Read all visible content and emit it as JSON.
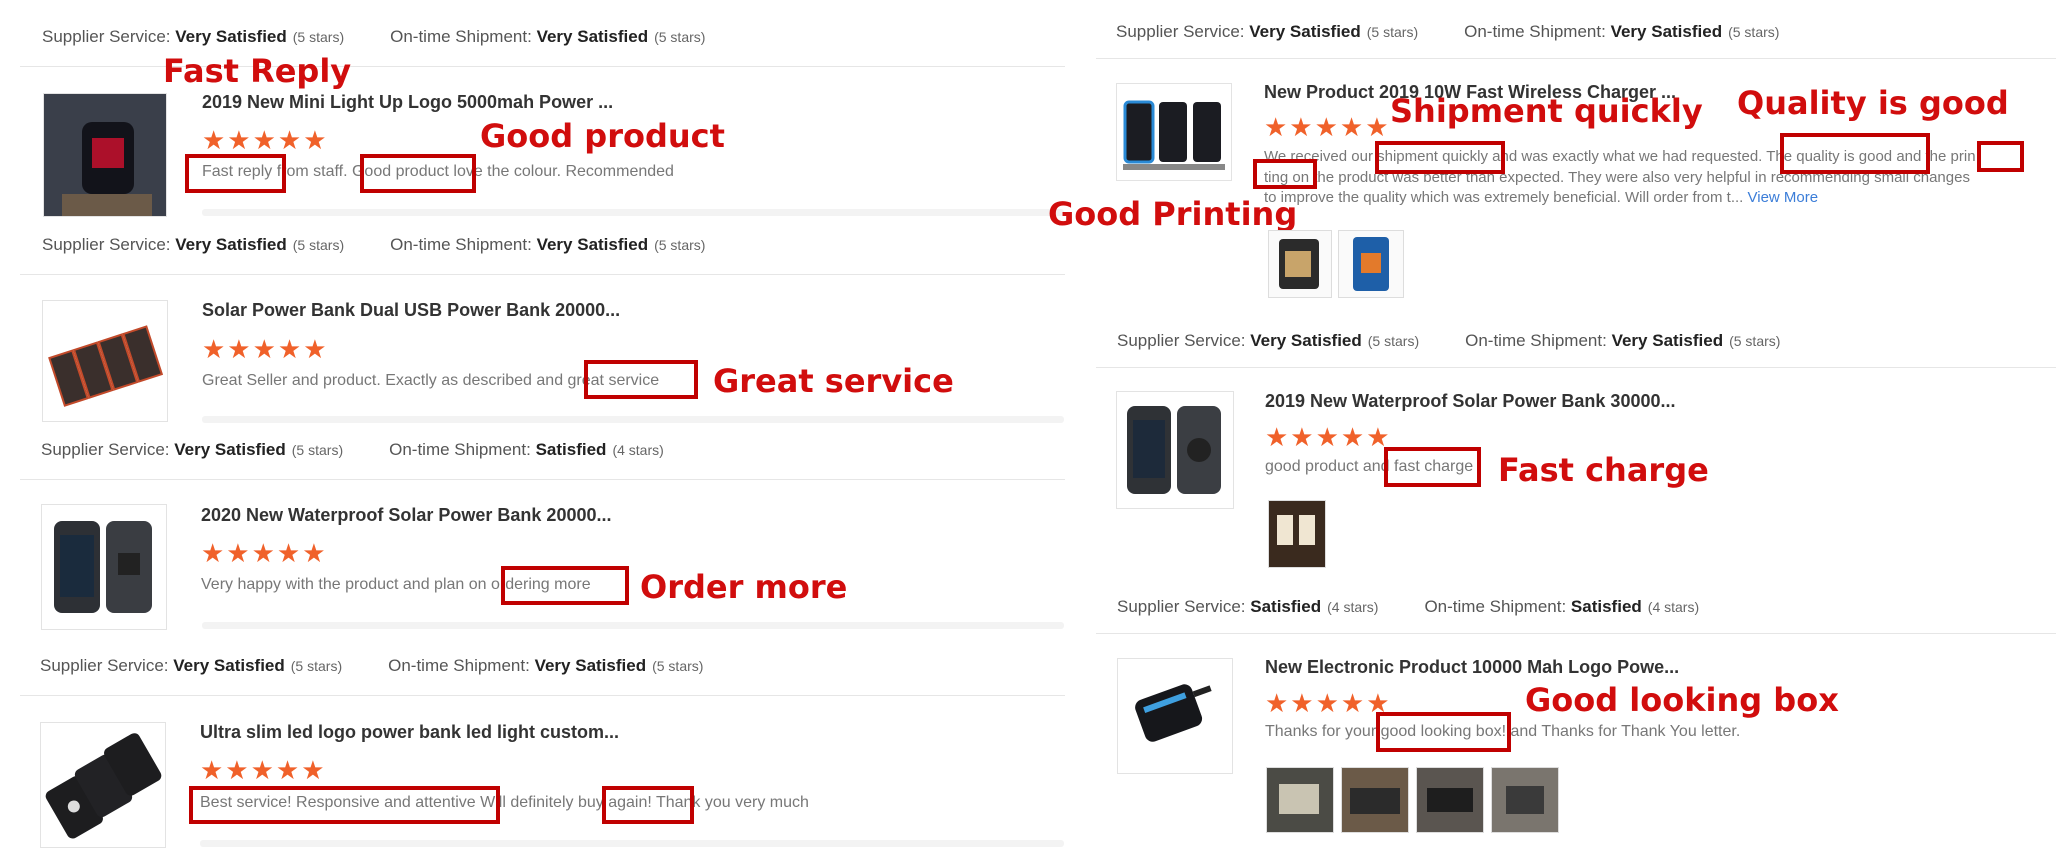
{
  "labels": {
    "supplier": "Supplier Service:",
    "shipment": "On-time Shipment:",
    "very_satisfied": "Very Satisfied",
    "satisfied": "Satisfied",
    "five": "(5 stars)",
    "four": "(4 stars)",
    "stars_glyph": "★★★★★",
    "view_more": "View More"
  },
  "left": {
    "r1": {
      "title": "2019 New Mini Light Up Logo 5000mah Power ...",
      "p1": "Fast reply",
      "p2": " from staff. ",
      "p3": "Good product",
      "p4": " love the colour. Recommended"
    },
    "r2": {
      "title": "Solar Power Bank Dual USB Power Bank 20000...",
      "p1": "Great Seller and product. Exactly as described and ",
      "p2": "great service"
    },
    "r3": {
      "title": "2020 New Waterproof Solar Power Bank 20000...",
      "p1": "Very happy with the product and plan on ",
      "p2": "ordering more"
    },
    "r4": {
      "title": "Ultra slim led logo power bank led light custom...",
      "p1": "Best service! Responsive and attentive",
      "p2": " Will definitely ",
      "p3": "buy again!",
      "p4": " Thank you very much"
    }
  },
  "right": {
    "r1": {
      "title": "New Product 2019 10W Fast Wireless Charger ...",
      "line1a": "We received our ",
      "line1b": "shipment quickly",
      "line1c": " and was exactly what we had requested. ",
      "line1d": "The quality is good",
      "line1e": " and the ",
      "line1f": "prin",
      "line2a": "ting on",
      "line2b": " the product was better than expected. They were also very helpful in recommending small changes",
      "line3": "to improve the quality which was extremely beneficial. Will order from t... "
    },
    "r2": {
      "title": "2019 New Waterproof Solar Power Bank 30000...",
      "p1": "good product and ",
      "p2": "fast charge"
    },
    "r3": {
      "title": "New Electronic Product 10000 Mah Logo Powe...",
      "p1": "Thanks for your ",
      "p2": "good looking box!",
      "p3": " and Thanks for Thank You letter."
    }
  },
  "callouts": {
    "fast_reply": "Fast Reply",
    "good_product": "Good product",
    "great_service": "Great service",
    "order_more": "Order more",
    "shipment_quickly": "Shipment quickly",
    "quality_good": "Quality is good",
    "good_printing": "Good Printing",
    "fast_charge": "Fast charge",
    "good_looking_box": "Good looking box"
  },
  "colors": {
    "star": "#f0612a",
    "highlight": "#c00000",
    "callout": "#d10d0d",
    "link": "#3b7dd8"
  }
}
